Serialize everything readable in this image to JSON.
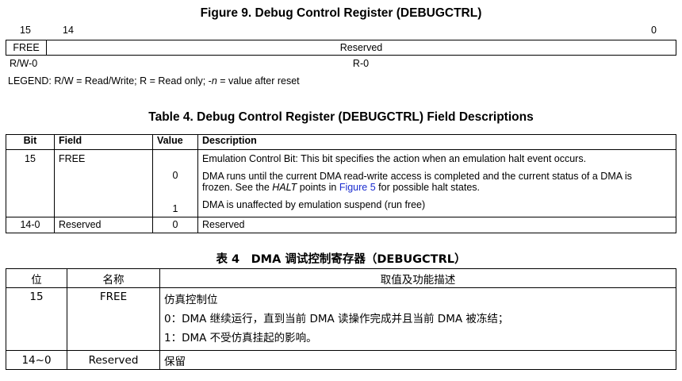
{
  "figure": {
    "title": "Figure 9. Debug Control Register (DEBUGCTRL)",
    "bit_labels": {
      "b15": "15",
      "b14": "14",
      "b0": "0"
    },
    "fields": [
      {
        "name": "FREE",
        "access": "R/W-0"
      },
      {
        "name": "Reserved",
        "access": "R-0"
      }
    ],
    "legend_prefix": "LEGEND: R/W = Read/Write; R = Read only; -",
    "legend_n": "n",
    "legend_suffix": " = value after reset"
  },
  "table_en": {
    "title": "Table 4. Debug Control Register (DEBUGCTRL) Field Descriptions",
    "headers": [
      "Bit",
      "Field",
      "Value",
      "Description"
    ],
    "row1": {
      "bit": "15",
      "field": "FREE",
      "desc_main": "Emulation Control Bit: This bit specifies the action when an emulation halt event occurs.",
      "value0": "0",
      "desc0_a": "DMA runs until the current DMA read-write access is completed and the current status of a DMA is",
      "desc0_b_pre": "frozen. See the ",
      "desc0_b_halt": "HALT",
      "desc0_b_mid": " points in ",
      "desc0_b_link": "Figure 5",
      "desc0_b_post": " for possible halt states.",
      "value1": "1",
      "desc1": "DMA is unaffected by emulation suspend (run free)"
    },
    "row2": {
      "bit": "14-0",
      "field": "Reserved",
      "value": "0",
      "desc": "Reserved"
    }
  },
  "table_cn": {
    "title": "表 4　DMA 调试控制寄存器（DEBUGCTRL）",
    "headers": [
      "位",
      "名称",
      "取值及功能描述"
    ],
    "row1": {
      "bit": "15",
      "field": "FREE",
      "lines": [
        "仿真控制位",
        "0：DMA 继续运行，直到当前 DMA 读操作完成并且当前 DMA 被冻结；",
        "1：DMA 不受仿真挂起的影响。"
      ]
    },
    "row2": {
      "bit": "14~0",
      "field": "Reserved",
      "desc": "保留"
    }
  }
}
